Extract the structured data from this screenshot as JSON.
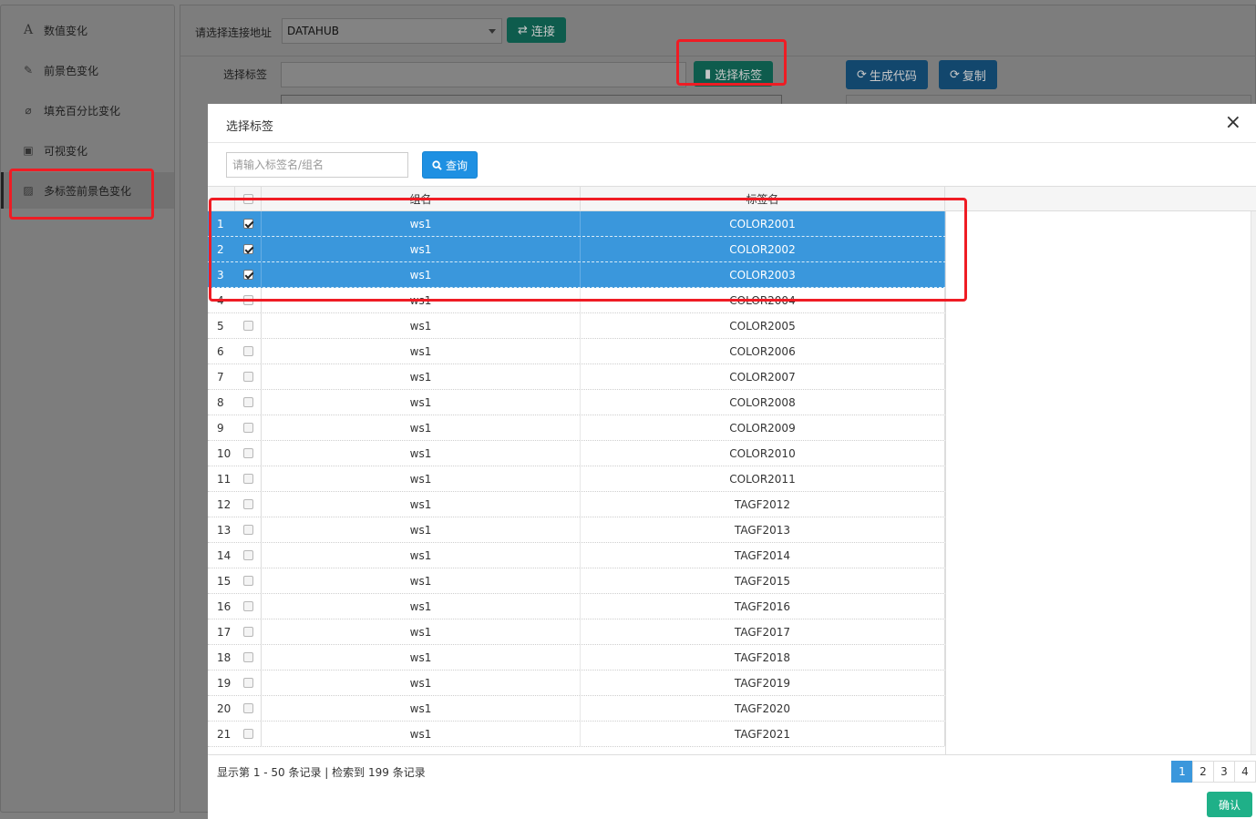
{
  "sidebar": {
    "items": [
      {
        "label": "数值变化",
        "icon": "font-icon",
        "glyph": "A"
      },
      {
        "label": "前景色变化",
        "icon": "brush-icon",
        "glyph": "✎"
      },
      {
        "label": "填充百分比变化",
        "icon": "thermometer-icon",
        "glyph": "⌀"
      },
      {
        "label": "可视变化",
        "icon": "frame-icon",
        "glyph": "▣"
      },
      {
        "label": "多标签前景色变化",
        "icon": "image-icon",
        "glyph": "▨"
      }
    ]
  },
  "connection": {
    "label": "请选择连接地址",
    "selected": "DATAHUB",
    "connect_label": "连接",
    "connect_icon": "⇄"
  },
  "tags": {
    "label": "选择标签",
    "select_label": "选择标签",
    "generate_label": "生成代码",
    "copy_label": "复制",
    "refresh_icon": "⟳"
  },
  "modal": {
    "title": "选择标签",
    "close": "×",
    "search_placeholder": "请输入标签名/组名",
    "query_label": "查询",
    "columns": {
      "group": "组名",
      "tag": "标签名"
    },
    "rows": [
      {
        "n": "1",
        "group": "ws1",
        "tag": "COLOR2001",
        "checked": true
      },
      {
        "n": "2",
        "group": "ws1",
        "tag": "COLOR2002",
        "checked": true
      },
      {
        "n": "3",
        "group": "ws1",
        "tag": "COLOR2003",
        "checked": true
      },
      {
        "n": "4",
        "group": "ws1",
        "tag": "COLOR2004",
        "checked": false
      },
      {
        "n": "5",
        "group": "ws1",
        "tag": "COLOR2005",
        "checked": false
      },
      {
        "n": "6",
        "group": "ws1",
        "tag": "COLOR2006",
        "checked": false
      },
      {
        "n": "7",
        "group": "ws1",
        "tag": "COLOR2007",
        "checked": false
      },
      {
        "n": "8",
        "group": "ws1",
        "tag": "COLOR2008",
        "checked": false
      },
      {
        "n": "9",
        "group": "ws1",
        "tag": "COLOR2009",
        "checked": false
      },
      {
        "n": "10",
        "group": "ws1",
        "tag": "COLOR2010",
        "checked": false
      },
      {
        "n": "11",
        "group": "ws1",
        "tag": "COLOR2011",
        "checked": false
      },
      {
        "n": "12",
        "group": "ws1",
        "tag": "TAGF2012",
        "checked": false
      },
      {
        "n": "13",
        "group": "ws1",
        "tag": "TAGF2013",
        "checked": false
      },
      {
        "n": "14",
        "group": "ws1",
        "tag": "TAGF2014",
        "checked": false
      },
      {
        "n": "15",
        "group": "ws1",
        "tag": "TAGF2015",
        "checked": false
      },
      {
        "n": "16",
        "group": "ws1",
        "tag": "TAGF2016",
        "checked": false
      },
      {
        "n": "17",
        "group": "ws1",
        "tag": "TAGF2017",
        "checked": false
      },
      {
        "n": "18",
        "group": "ws1",
        "tag": "TAGF2018",
        "checked": false
      },
      {
        "n": "19",
        "group": "ws1",
        "tag": "TAGF2019",
        "checked": false
      },
      {
        "n": "20",
        "group": "ws1",
        "tag": "TAGF2020",
        "checked": false
      },
      {
        "n": "21",
        "group": "ws1",
        "tag": "TAGF2021",
        "checked": false
      }
    ],
    "page_info": "显示第 1 - 50 条记录 | 检索到 199 条记录",
    "pages": [
      "1",
      "2",
      "3",
      "4"
    ],
    "active_page": "1",
    "confirm_label": "确认"
  },
  "colors": {
    "selected_row": "#3a97dc",
    "primary_blue": "#1e90e2",
    "confirm_green": "#1fb088",
    "annotation_red": "#ef1c24"
  }
}
